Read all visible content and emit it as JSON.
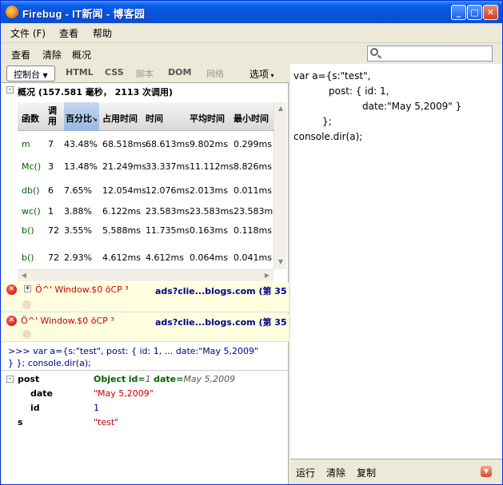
{
  "window": {
    "title": "Firebug - IT新闻 - 博客园"
  },
  "menubar": {
    "items": [
      "文件 (F)",
      "查看",
      "帮助"
    ]
  },
  "toolbar": {
    "items": [
      "查看",
      "清除",
      "概况"
    ],
    "search_placeholder": ""
  },
  "tabs": {
    "console": "控制台",
    "html": "HTML",
    "css": "CSS",
    "script": "脚本",
    "dom": "DOM",
    "net": "网络",
    "options": "选项"
  },
  "profile": {
    "summary": "概况 (157.581 毫秒， 2113 次调用)",
    "columns": [
      "函数",
      "调用",
      "百分比",
      "占用时间",
      "时间",
      "平均时间",
      "最小时间"
    ],
    "rows": [
      [
        "m",
        "7",
        "43.48%",
        "68.518ms",
        "68.613ms",
        "9.802ms",
        "0.299ms"
      ],
      [
        "Mc()",
        "3",
        "13.48%",
        "21.249ms",
        "33.337ms",
        "11.112ms",
        "8.826ms"
      ],
      [
        "db()",
        "6",
        "7.65%",
        "12.054ms",
        "12.076ms",
        "2.013ms",
        "0.011ms"
      ],
      [
        "wc()",
        "1",
        "3.88%",
        "6.122ms",
        "23.583ms",
        "23.583ms",
        "23.583ms"
      ],
      [
        "b()",
        "72",
        "3.55%",
        "5.588ms",
        "11.735ms",
        "0.163ms",
        "0.118ms"
      ],
      [
        "b()",
        "72",
        "2.93%",
        "4.612ms",
        "4.612ms",
        "0.064ms",
        "0.041ms"
      ]
    ]
  },
  "errors": [
    {
      "message": "Ö^' Window.$0 öCP ³",
      "source": "ads?clie...blogs.com (第 35 行)"
    },
    {
      "message": "Ö^' Window.$0 öCP ³",
      "source": "ads?clie...blogs.com (第 35 行)"
    }
  ],
  "command": {
    "line1": ">>> var a={s:\"test\",           post: { id: 1,           ... date:\"May 5,2009\"",
    "line2": "}           }; console.dir(a);"
  },
  "dir": {
    "post_key": "post",
    "post_value_label": "Object",
    "post_value_detail_id": "id=",
    "post_value_id": "1",
    "post_value_detail_date": "date=",
    "post_value_date": "May 5,2009",
    "date_key": "date",
    "date_value": "\"May 5,2009\"",
    "id_key": "id",
    "id_value": "1",
    "s_key": "s",
    "s_value": "\"test\""
  },
  "editor": {
    "lines": [
      "var a={s:\"test\",",
      "post: { id: 1,",
      "date:\"May 5,2009\" }",
      "};",
      "console.dir(a);"
    ]
  },
  "rightbar": {
    "run": "运行",
    "clear": "清除",
    "copy": "复制"
  }
}
